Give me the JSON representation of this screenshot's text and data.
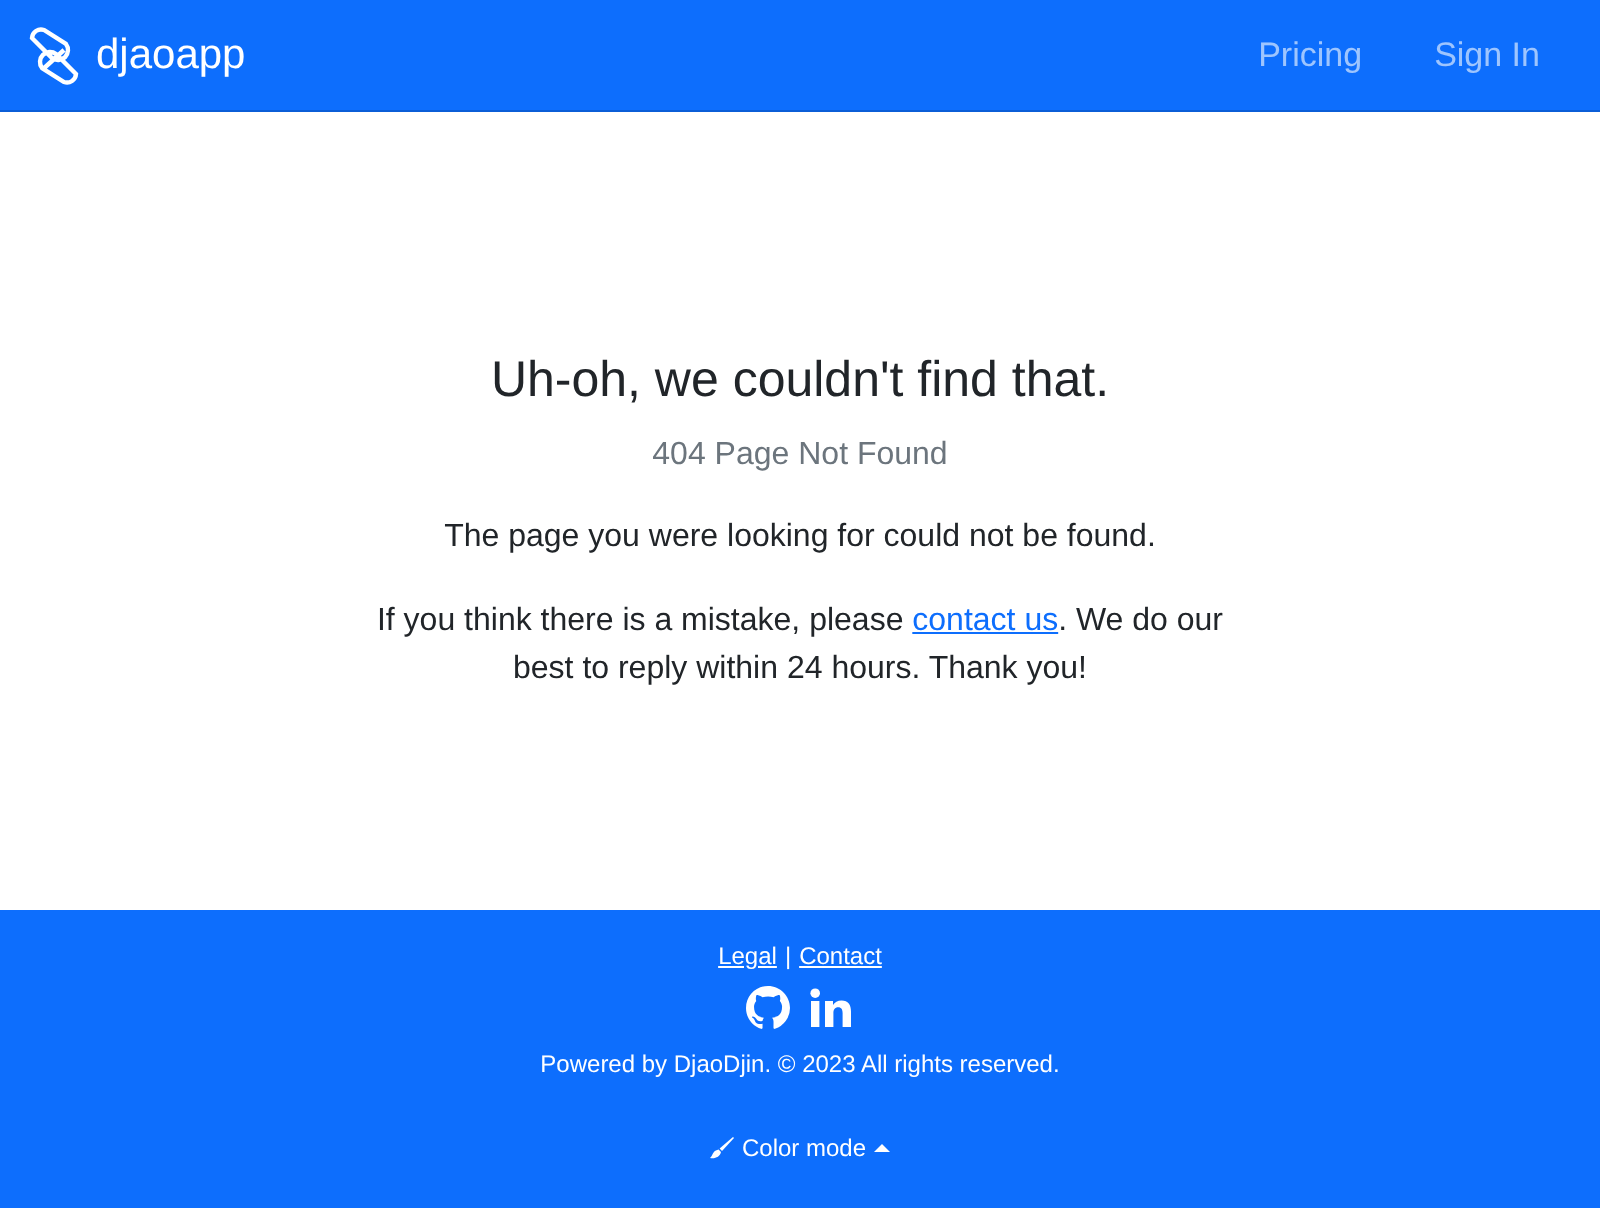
{
  "navbar": {
    "brand": "djaoapp",
    "links": [
      {
        "label": "Pricing"
      },
      {
        "label": "Sign In"
      }
    ]
  },
  "error": {
    "title": "Uh-oh, we couldn't find that.",
    "subtitle": "404 Page Not Found",
    "message": "The page you were looking for could not be found.",
    "help_before": "If you think there is a mistake, please ",
    "help_link": "contact us",
    "help_after": ". We do our best to reply within 24 hours. Thank you!"
  },
  "footer": {
    "links": [
      {
        "label": "Legal"
      },
      {
        "label": "Contact"
      }
    ],
    "separator": "|",
    "copyright": "Powered by DjaoDjin. © 2023 All rights reserved.",
    "color_mode": "Color mode"
  }
}
